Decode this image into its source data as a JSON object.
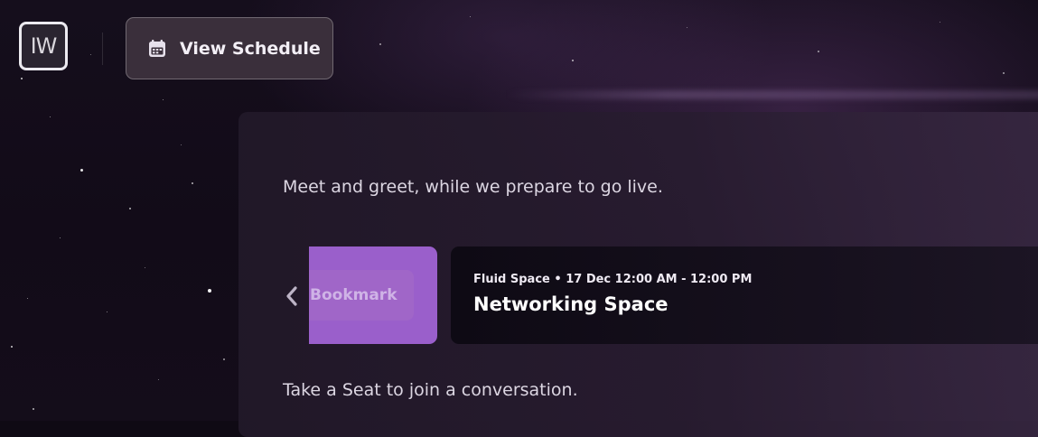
{
  "header": {
    "logo_text": "IW",
    "schedule_button": {
      "label": "View Schedule",
      "icon": "calendar-icon"
    }
  },
  "main": {
    "intro_text": "Meet and greet, while we prepare to go live.",
    "carousel": {
      "prev_icon": "chevron-left-icon",
      "bookmark_label": "Bookmark",
      "session": {
        "meta": "Fluid Space • 17 Dec 12:00 AM - 12:00 PM",
        "title": "Networking Space"
      }
    },
    "join_prompt": "Take a Seat to join a conversation."
  },
  "colors": {
    "background": "#0f0a14",
    "button_bg": "#3a2f3b",
    "bookmark_accent": "#9a5fcb",
    "session_card_bg": "#0e0a14"
  }
}
